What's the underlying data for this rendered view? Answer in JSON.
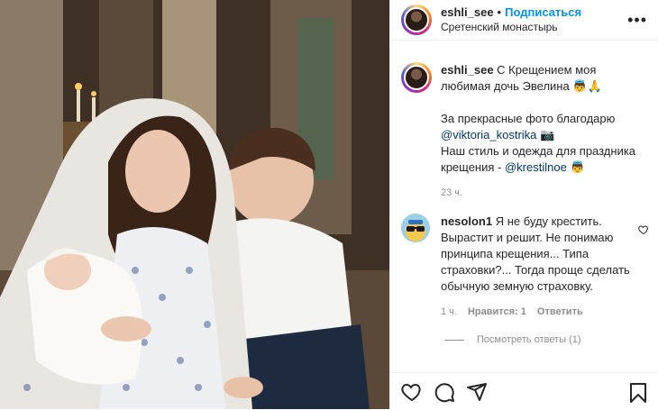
{
  "post": {
    "username": "eshli_see",
    "follow_label": "Подписаться",
    "separator": "•",
    "location": "Сретенский монастырь",
    "more_label": "•••",
    "caption": {
      "line1_text": "С Крещением моя любимая дочь Эвелина 👼🙏",
      "line2_prefix": "За прекрасные фото благодарю",
      "line2_mention": "@viktoria_kostrika",
      "line2_suffix": "📷",
      "line3_prefix": "Наш стиль и одежда для праздника крещения -",
      "line3_mention": "@krestilnoe",
      "line3_suffix": "👼"
    },
    "time": "23 ч."
  },
  "comment": {
    "username": "nesolon1",
    "text": "Я не буду крестить. Вырастит и решит. Не понимаю принципа крещения... Типа страховки?... Тогда проще сделать обычную земную страховку.",
    "time": "1 ч.",
    "likes": "Нравится: 1",
    "reply_label": "Ответить",
    "view_replies": "Посмотреть ответы (1)"
  },
  "icons": {
    "like": "heart-icon",
    "comment": "comment-icon",
    "share": "share-icon",
    "save": "bookmark-icon"
  }
}
